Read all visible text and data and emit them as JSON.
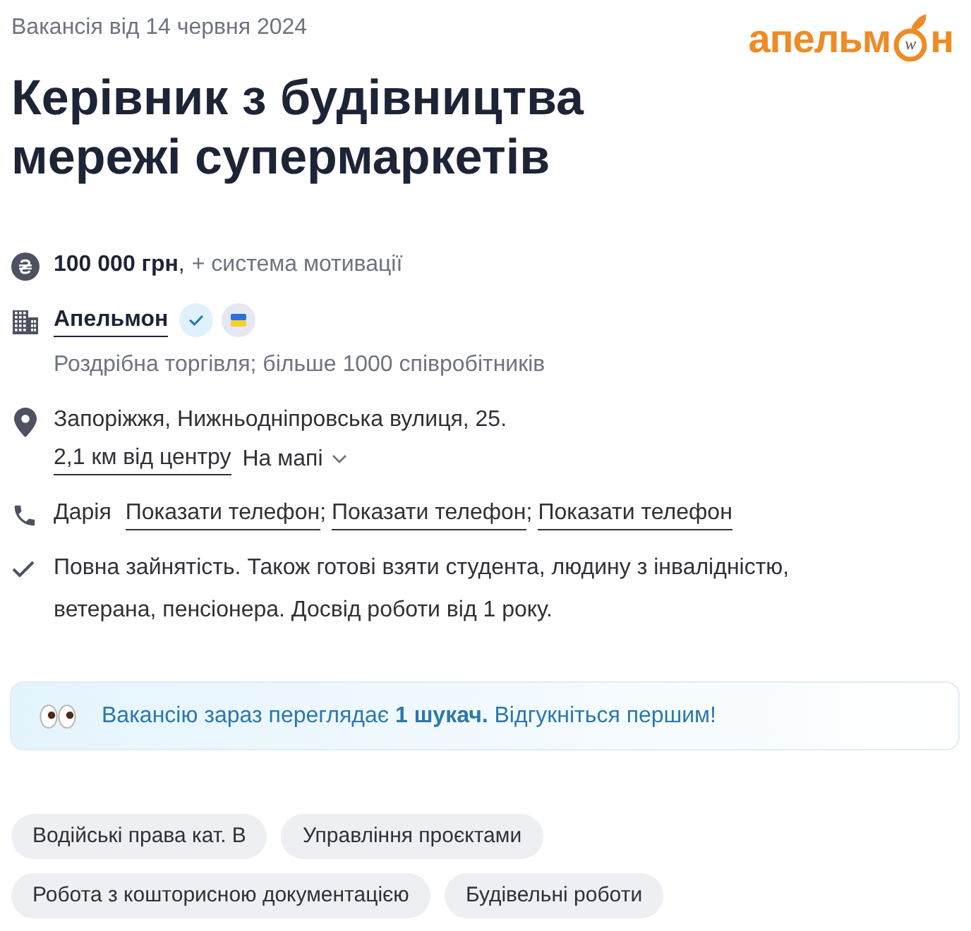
{
  "posted": "Вакансія від 14 червня 2024",
  "logo": {
    "start": "апельм",
    "ring_letter": "w",
    "end": "н"
  },
  "title": "Керівник з будівництва мережі супермаркетів",
  "salary": {
    "amount": "100 000 грн",
    "separator": ",",
    "extra": "+ система мотивації"
  },
  "company": {
    "name": "Апельмон",
    "verified": true,
    "flag_badge": true,
    "details": "Роздрібна торгівля; більше 1000 співробітників"
  },
  "location": {
    "address": "Запоріжжя, Нижньодніпровська вулиця, 25.",
    "distance": "2,1 км від центру",
    "map_link": "На мапі"
  },
  "contact": {
    "name": "Дарія",
    "separator": ";",
    "phones": [
      "Показати телефон",
      "Показати телефон",
      "Показати телефон"
    ]
  },
  "conditions": "Повна зайнятість. Також готові взяти студента, людину з інвалідністю, ветерана, пенсіонера. Досвід роботи від 1 року.",
  "alert": {
    "text": "Вакансію зараз переглядає **1 шукач.** Відгукніться першим!"
  },
  "tags": [
    "Водійські права кат. B",
    "Управління проєктами",
    "Робота з кошторисною документацією",
    "Будівельні роботи"
  ]
}
